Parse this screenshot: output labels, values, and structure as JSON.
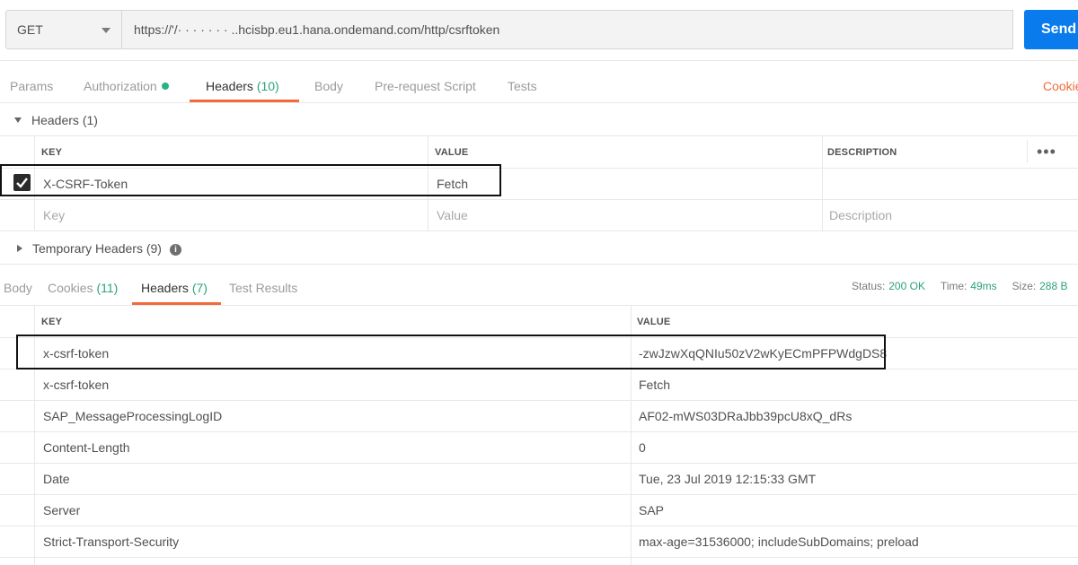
{
  "request": {
    "method": "GET",
    "url": "https://'/·  ·  ·  ·  ·  ·  ·  ..hcisbp.eu1.hana.ondemand.com/http/csrftoken",
    "send_label": "Send"
  },
  "request_tabs": {
    "params": "Params",
    "authorization": "Authorization",
    "headers_label": "Headers",
    "headers_count": "(10)",
    "body": "Body",
    "prerequest": "Pre-request Script",
    "tests": "Tests",
    "cookies_link": "Cookie"
  },
  "headers_section": {
    "title": "Headers",
    "count": "(1)",
    "columns": {
      "key": "KEY",
      "value": "VALUE",
      "description": "DESCRIPTION"
    },
    "more_icon": "more-horizontal-icon",
    "rows": [
      {
        "key": "X-CSRF-Token",
        "value": "Fetch",
        "description": "",
        "checked": true
      }
    ],
    "placeholder": {
      "key": "Key",
      "value": "Value",
      "description": "Description"
    }
  },
  "temporary_headers": {
    "title": "Temporary Headers",
    "count": "(9)"
  },
  "response_tabs": {
    "body": "Body",
    "cookies_label": "Cookies",
    "cookies_count": "(11)",
    "headers_label": "Headers",
    "headers_count": "(7)",
    "test_results": "Test Results"
  },
  "response_status": {
    "status_label": "Status:",
    "status_value": "200 OK",
    "time_label": "Time:",
    "time_value": "49ms",
    "size_label": "Size:",
    "size_value": "288 B"
  },
  "response_headers": {
    "columns": {
      "key": "KEY",
      "value": "VALUE"
    },
    "rows": [
      {
        "key": "x-csrf-token",
        "value": "-zwJzwXqQNIu50zV2wKyECmPFPWdgDS8"
      },
      {
        "key": "x-csrf-token",
        "value": "Fetch"
      },
      {
        "key": "SAP_MessageProcessingLogID",
        "value": "AF02-mWS03DRaJbb39pcU8xQ_dRs"
      },
      {
        "key": "Content-Length",
        "value": "0"
      },
      {
        "key": "Date",
        "value": "Tue, 23 Jul 2019 12:15:33 GMT"
      },
      {
        "key": "Server",
        "value": "SAP"
      },
      {
        "key": "Strict-Transport-Security",
        "value": "max-age=31536000; includeSubDomains; preload"
      }
    ]
  },
  "colors": {
    "accent": "#f26b3a",
    "send_button": "#097bed",
    "count_green": "#2aa37a"
  }
}
